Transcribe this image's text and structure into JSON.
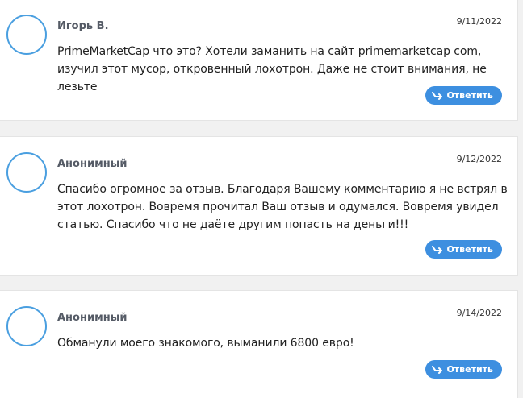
{
  "comments": [
    {
      "author": "Игорь В.",
      "date": "9/11/2022",
      "text": "PrimeMarketCap что это? Хотели заманить на сайт primemarketcap com, изучил этот мусор, откровенный лохотрон. Даже не стоит внимания, не лезьте",
      "reply_label": "Ответить"
    },
    {
      "author": "Анонимный",
      "date": "9/12/2022",
      "text": "Спасибо огромное за отзыв. Благодаря Вашему комментарию я не встрял в этот лохотрон. Вовремя прочитал Ваш отзыв и одумался. Вовремя увидел статью. Спасибо что не даёте другим попасть на деньги!!!",
      "reply_label": "Ответить"
    },
    {
      "author": "Анонимный",
      "date": "9/14/2022",
      "text": "Обманули моего знакомого, выманили 6800 евро!",
      "reply_label": "Ответить"
    }
  ],
  "icons": {
    "reply": "reply-arrow-icon"
  },
  "colors": {
    "accent": "#3d8fe0",
    "avatar_ring": "#4a9fe0",
    "author": "#555b66"
  }
}
